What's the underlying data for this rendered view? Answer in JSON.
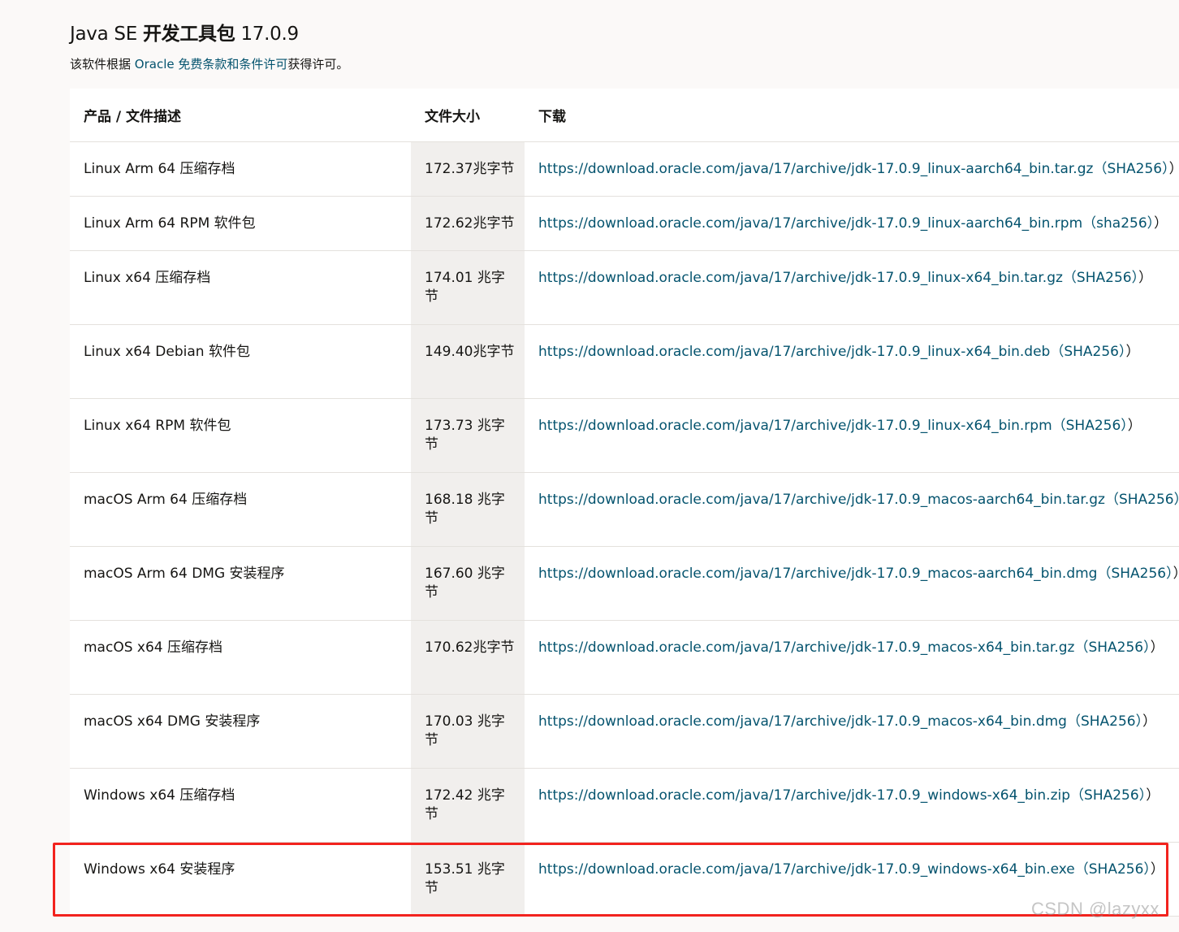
{
  "header": {
    "title_prefix": "Java SE ",
    "title_bold": "开发工具包",
    "title_suffix": " 17.0.9",
    "license_before": "该软件根据 ",
    "license_link": "Oracle 免费条款和条件许可",
    "license_after": "获得许可。"
  },
  "table": {
    "columns": [
      "产品 / 文件描述",
      "文件大小",
      "下载"
    ],
    "rows": [
      {
        "desc": "Linux Arm 64 压缩存档",
        "size": "172.37兆字节",
        "url": "https://download.oracle.com/java/17/archive/jdk-17.0.9_linux-aarch64_bin.tar.gz",
        "checksum": "SHA256"
      },
      {
        "desc": "Linux Arm 64 RPM 软件包",
        "size": "172.62兆字节",
        "url": "https://download.oracle.com/java/17/archive/jdk-17.0.9_linux-aarch64_bin.rpm",
        "checksum": "sha256"
      },
      {
        "desc": "Linux x64 压缩存档",
        "size": "174.01 兆字节",
        "url": "https://download.oracle.com/java/17/archive/jdk-17.0.9_linux-x64_bin.tar.gz",
        "checksum": "SHA256"
      },
      {
        "desc": "Linux x64 Debian 软件包",
        "size": "149.40兆字节",
        "url": "https://download.oracle.com/java/17/archive/jdk-17.0.9_linux-x64_bin.deb",
        "checksum": "SHA256"
      },
      {
        "desc": "Linux x64 RPM 软件包",
        "size": "173.73 兆字节",
        "url": "https://download.oracle.com/java/17/archive/jdk-17.0.9_linux-x64_bin.rpm",
        "checksum": "SHA256"
      },
      {
        "desc": "macOS Arm 64 压缩存档",
        "size": "168.18 兆字节",
        "url": "https://download.oracle.com/java/17/archive/jdk-17.0.9_macos-aarch64_bin.tar.gz",
        "checksum": "SHA256"
      },
      {
        "desc": "macOS Arm 64 DMG 安装程序",
        "size": "167.60 兆字节",
        "url": "https://download.oracle.com/java/17/archive/jdk-17.0.9_macos-aarch64_bin.dmg",
        "checksum": "SHA256"
      },
      {
        "desc": "macOS x64 压缩存档",
        "size": "170.62兆字节",
        "url": "https://download.oracle.com/java/17/archive/jdk-17.0.9_macos-x64_bin.tar.gz",
        "checksum": "SHA256"
      },
      {
        "desc": "macOS x64 DMG 安装程序",
        "size": "170.03 兆字节",
        "url": "https://download.oracle.com/java/17/archive/jdk-17.0.9_macos-x64_bin.dmg",
        "checksum": "SHA256"
      },
      {
        "desc": "Windows x64 压缩存档",
        "size": "172.42 兆字节",
        "url": "https://download.oracle.com/java/17/archive/jdk-17.0.9_windows-x64_bin.zip",
        "checksum": "SHA256"
      },
      {
        "desc": "Windows x64 安装程序",
        "size": "153.51 兆字节",
        "url": "https://download.oracle.com/java/17/archive/jdk-17.0.9_windows-x64_bin.exe",
        "checksum": "SHA256"
      }
    ]
  },
  "paren_open": "（",
  "paren_close": "）",
  "paren_close_outer": "）",
  "watermark": "CSDN @lazyxx",
  "colors": {
    "link": "#04536e",
    "highlight": "#f2231e",
    "size_bg": "#f1efed",
    "page_bg": "#fbf9f8"
  }
}
